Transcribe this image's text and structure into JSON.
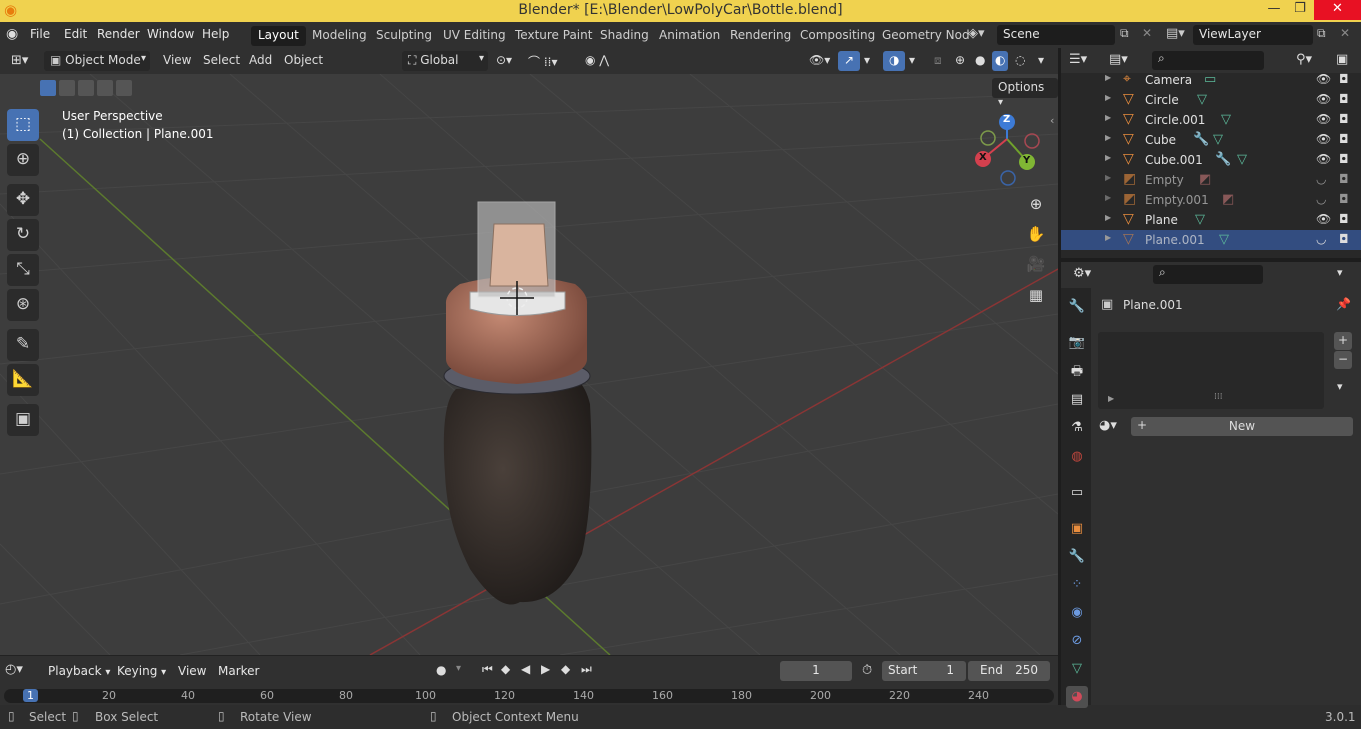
{
  "window": {
    "title": "Blender* [E:\\Blender\\LowPolyCar\\Bottle.blend]",
    "minimize": "—",
    "maximize": "❐",
    "close": "✕"
  },
  "menubar": {
    "items": [
      "File",
      "Edit",
      "Render",
      "Window",
      "Help"
    ]
  },
  "workspaces": {
    "tabs": [
      "Layout",
      "Modeling",
      "Sculpting",
      "UV Editing",
      "Texture Paint",
      "Shading",
      "Animation",
      "Rendering",
      "Compositing",
      "Geometry Nod"
    ],
    "active": "Layout"
  },
  "scene": {
    "label": "Scene",
    "viewlayer": "ViewLayer"
  },
  "viewport_header": {
    "mode": "Object Mode",
    "menus": [
      "View",
      "Select",
      "Add",
      "Object"
    ],
    "orientation": "Global",
    "options": "Options"
  },
  "viewport": {
    "perspective": "User Perspective",
    "collection": "(1) Collection | Plane.001",
    "gizmo": {
      "x": "X",
      "y": "Y",
      "z": "Z"
    }
  },
  "tools": [
    "select-box",
    "cursor",
    "move",
    "rotate",
    "scale",
    "transform",
    "annotate",
    "measure",
    "add-cube"
  ],
  "timeline": {
    "menus": [
      "Playback",
      "Keying",
      "View",
      "Marker"
    ],
    "current_frame": "1",
    "start_label": "Start",
    "start": "1",
    "end_label": "End",
    "end": "250",
    "ticks": [
      "1",
      "20",
      "40",
      "60",
      "80",
      "100",
      "120",
      "140",
      "160",
      "180",
      "200",
      "220",
      "240"
    ]
  },
  "status": {
    "select": "Select",
    "box_select": "Box Select",
    "rotate_view": "Rotate View",
    "context_menu": "Object Context Menu",
    "version": "3.0.1"
  },
  "outliner": {
    "items": [
      {
        "name": "Camera",
        "icon": "camera-icon",
        "extra": "camera-data-icon"
      },
      {
        "name": "Circle",
        "icon": "mesh-icon",
        "extra": "mesh-data-icon"
      },
      {
        "name": "Circle.001",
        "icon": "mesh-icon",
        "extra": "mesh-data-icon"
      },
      {
        "name": "Cube",
        "icon": "mesh-icon",
        "extra": "modifier-mesh-icon"
      },
      {
        "name": "Cube.001",
        "icon": "mesh-icon",
        "extra": "modifier-mesh-icon"
      },
      {
        "name": "Empty",
        "icon": "empty-image-icon",
        "extra": "image-icon"
      },
      {
        "name": "Empty.001",
        "icon": "empty-image-icon",
        "extra": "image-icon"
      },
      {
        "name": "Plane",
        "icon": "mesh-icon",
        "extra": "mesh-data-icon"
      },
      {
        "name": "Plane.001",
        "icon": "mesh-icon",
        "extra": "mesh-data-icon"
      }
    ]
  },
  "properties": {
    "object_name": "Plane.001",
    "new_label": "New"
  },
  "colors": {
    "accent": "#4772b3",
    "title_bar": "#f0d24f",
    "selected_row": "#334d80",
    "grid_x": "#8a3535",
    "grid_y": "#5c7a2e"
  }
}
